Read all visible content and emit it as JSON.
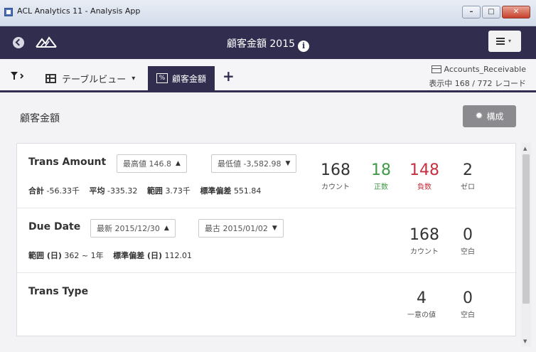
{
  "window": {
    "title": "ACL Analytics 11 - Analysis App",
    "minimize_glyph": "–",
    "maximize_glyph": "□",
    "close_glyph": "✕"
  },
  "header": {
    "title": "顧客金額 2015",
    "info_glyph": "i",
    "menu_chevron": "▾"
  },
  "toolbar": {
    "table_view_label": "テーブルビュー",
    "table_view_chevron": "▾",
    "active_tab_label": "顧客金額",
    "active_tab_icon": "%",
    "add_tab_glyph": "+",
    "source_name": "Accounts_Receivable",
    "record_count": "表示中 168 / 772 レコード"
  },
  "content": {
    "title": "顧客金額",
    "config_label": "構成",
    "gear_glyph": "✹"
  },
  "fields": [
    {
      "name": "Trans Amount",
      "chips": [
        {
          "label": "最高値 146.8",
          "chevron": "▲"
        },
        {
          "label": "最低値 -3,582.98",
          "chevron": "▼"
        }
      ],
      "stats": [
        {
          "key": "合計",
          "value": "-56.33千"
        },
        {
          "key": "平均",
          "value": "-335.32"
        },
        {
          "key": "範囲",
          "value": "3.73千"
        },
        {
          "key": "標準偏差",
          "value": "551.84"
        }
      ],
      "metrics": [
        {
          "value": "168",
          "label": "カウント",
          "tone": "default"
        },
        {
          "value": "18",
          "label": "正数",
          "tone": "green"
        },
        {
          "value": "148",
          "label": "負数",
          "tone": "red"
        },
        {
          "value": "2",
          "label": "ゼロ",
          "tone": "default"
        }
      ]
    },
    {
      "name": "Due Date",
      "chips": [
        {
          "label": "最新 2015/12/30",
          "chevron": "▲"
        },
        {
          "label": "最古 2015/01/02",
          "chevron": "▼"
        }
      ],
      "stats": [
        {
          "key": "範囲 (日)",
          "value": "362 ~ 1年"
        },
        {
          "key": "標準偏差 (日)",
          "value": "112.01"
        }
      ],
      "metrics": [
        {
          "value": "168",
          "label": "カウント",
          "tone": "default"
        },
        {
          "value": "0",
          "label": "空白",
          "tone": "default"
        }
      ]
    },
    {
      "name": "Trans Type",
      "metrics": [
        {
          "value": "4",
          "label": "一意の値",
          "tone": "default"
        },
        {
          "value": "0",
          "label": "空白",
          "tone": "default"
        }
      ]
    }
  ],
  "scrollbar": {
    "up_glyph": "▲",
    "down_glyph": "▼"
  }
}
